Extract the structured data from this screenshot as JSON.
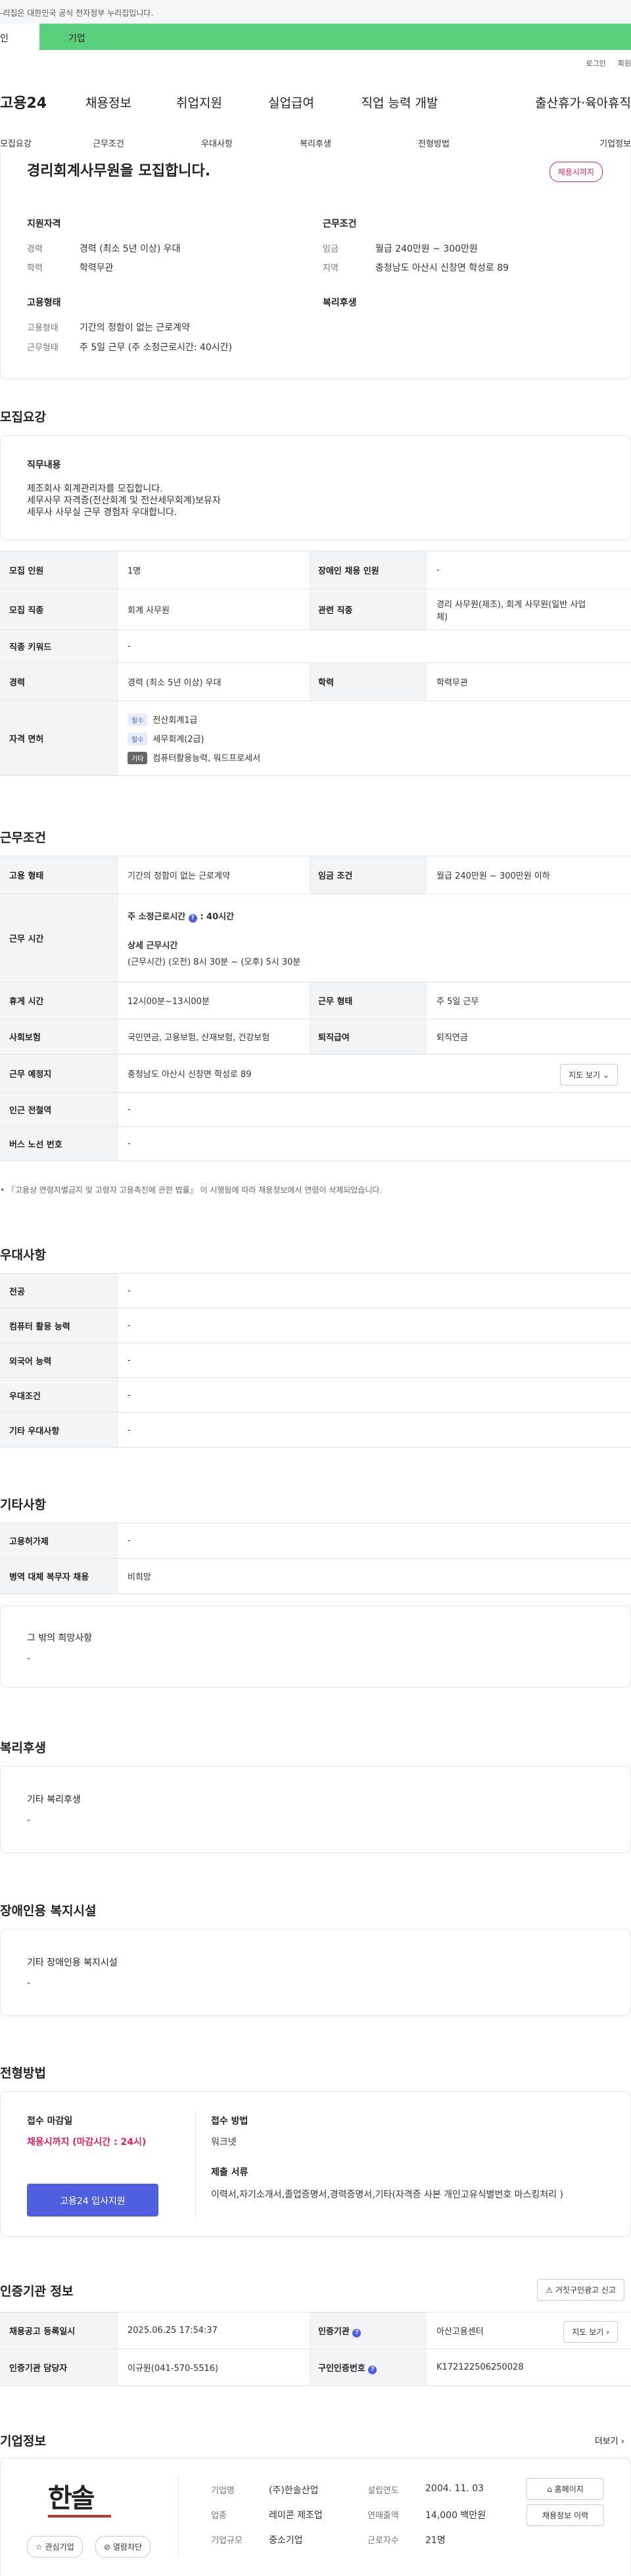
{
  "topbar": {
    "notice": "-리집은 대한민국 공식 전자정부 누리집입니다."
  },
  "tabs": {
    "personal": "인",
    "company": "기업"
  },
  "utility": {
    "login": "로그인",
    "join": "회원"
  },
  "gnb": {
    "logo": "고용24",
    "menu": [
      "채용정보",
      "취업지원",
      "실업급여",
      "직업 능력 개발",
      "출산휴가·육아휴직"
    ]
  },
  "lnb": [
    "모집요강",
    "근무조건",
    "우대사항",
    "복리후생",
    "전형방법",
    "기업정보"
  ],
  "summary": {
    "title": "경리회계사무원을 모집합니다.",
    "deadline_badge": "채용시까지",
    "qual_title": "지원자격",
    "qual": [
      {
        "label": "경력",
        "value": "경력 (최소 5년 이상) 우대"
      },
      {
        "label": "학력",
        "value": "학력무관"
      }
    ],
    "cond_title": "근무조건",
    "cond": [
      {
        "label": "임금",
        "value": "월급 240만원 ~ 300만원"
      },
      {
        "label": "지역",
        "value": "충청남도 아산시 신창면 학성로 89"
      }
    ],
    "emp_title": "고용형태",
    "emp": [
      {
        "label": "고용형태",
        "value": "기간의 정함이 없는 근로계약"
      },
      {
        "label": "근무형태",
        "value": "주 5일 근무 (주 소정근로시간: 40시간)"
      }
    ],
    "welfare_title": "복리후생"
  },
  "recruit": {
    "section_title": "모집요강",
    "job_box_title": "직무내용",
    "job_lines": [
      "제조회사 회계관리자를 모집합니다.",
      "세무사무 자격증(전산회계 및 전산세무회계)보유자",
      "세무사 사무실 근무 경험자 우대합니다."
    ],
    "rows": {
      "r1": {
        "l1": "모집 인원",
        "v1": "1명",
        "l2": "장애인 채용 인원",
        "v2": "-"
      },
      "r2": {
        "l1": "모집 직종",
        "v1": "회계 사무원",
        "l2": "관련 직종",
        "v2a": "경리 사무원(제조), 회계 사무원(일반 사업",
        "v2b": "체)"
      },
      "r3": {
        "l1": "직종 키워드",
        "v1": "-"
      },
      "r4": {
        "l1": "경력",
        "v1": "경력 (최소 5년 이상) 우대",
        "l2": "학력",
        "v2": "학력무관"
      },
      "r5": {
        "l1": "자격 면허",
        "items": [
          {
            "tag": "필수",
            "name": "전산회계1급"
          },
          {
            "tag": "필수",
            "name": "세무회계(2급)"
          },
          {
            "tag": "기타",
            "name": "컴퓨터활용능력, 워드프로세서"
          }
        ]
      }
    }
  },
  "work": {
    "section_title": "근무조건",
    "rows": {
      "emp": {
        "l1": "고용 형태",
        "v1": "기간의 정함이 없는 근로계약",
        "l2": "임금 조건",
        "v2": "월급 240만원 ~ 300만원 이하"
      },
      "time": {
        "l1": "근무 시간",
        "a": "주 소정근로시간",
        "b": ": 40시간",
        "c": "상세 근무시간",
        "d": "(근무시간) (오전) 8시 30분 ~ (오후) 5시 30분"
      },
      "rest": {
        "l1": "휴게 시간",
        "v1": "12시00분~13시00분",
        "l2": "근무 형태",
        "v2": "주 5일 근무"
      },
      "ins": {
        "l1": "사회보험",
        "v1": "국민연금, 고용보험, 산재보험, 건강보험",
        "l2": "퇴직급여",
        "v2": "퇴직연금"
      },
      "loc": {
        "l1": "근무 예정지",
        "v1": "충청남도 아산시 신창면 학성로 89",
        "btn": "지도 보기"
      },
      "subway": {
        "l1": "인근 전철역",
        "v1": "-"
      },
      "bus": {
        "l1": "버스 노선 번호",
        "v1": "-"
      }
    },
    "note": "• 『고용상 연령차별금지 및 고령자 고용촉진에 관한 법률』 이 시행됨에 따라 채용정보에서 연령이 삭제되었습니다."
  },
  "pref": {
    "section_title": "우대사항",
    "rows": [
      {
        "l": "전공",
        "v": "-"
      },
      {
        "l": "컴퓨터 활용 능력",
        "v": "-"
      },
      {
        "l": "외국어 능력",
        "v": "-"
      },
      {
        "l": "우대조건",
        "v": "-"
      },
      {
        "l": "기타 우대사항",
        "v": "-"
      }
    ]
  },
  "etc": {
    "section_title": "기타사항",
    "rows": [
      {
        "l": "고용허가제",
        "v": "-"
      },
      {
        "l": "병역 대체 복무자 채용",
        "v": "비희망"
      }
    ],
    "box_title": "그 밖의 희망사항",
    "box_value": "-"
  },
  "welfare": {
    "section_title": "복리후생",
    "box_title": "기타 복리후생",
    "box_value": "-"
  },
  "disabled": {
    "section_title": "장애인용 복지시설",
    "box_title": "기타 장애인용 복지시설",
    "box_value": "-"
  },
  "process": {
    "section_title": "전형방법",
    "deadline_label": "접수 마감일",
    "deadline_value": "채용시까지 (마감시간 : 24시)",
    "apply_btn": "고용24 입사지원",
    "method_label": "접수 방법",
    "method_value": "워크넷",
    "docs_label": "제출 서류",
    "docs_value": "이력서,자기소개서,졸업증명서,경력증명서,기타(자격증 사본 개인고유식별번호 마스킹처리 )"
  },
  "cert": {
    "section_title": "인증기관 정보",
    "report_btn": "거짓구인광고 신고",
    "r1": {
      "l1": "채용공고 등록일시",
      "v1": "2025.06.25 17:54:37",
      "l2": "인증기관",
      "v2": "아산고용센터",
      "btn": "지도 보기"
    },
    "r2": {
      "l1": "인증기관 담당자",
      "v1": "이규원(041-570-5516)",
      "l2": "구인인증번호",
      "v2": "K172122506250028"
    }
  },
  "company": {
    "section_title": "기업정보",
    "more": "더보기",
    "logo_text": "한솔",
    "fav_btn": "관심기업",
    "block_btn": "열람차단",
    "info": [
      {
        "l": "기업명",
        "v": "(주)한솔산업",
        "l2": "설립연도",
        "v2": "2004. 11. 03"
      },
      {
        "l": "업종",
        "v": "레미콘 제조업",
        "l2": "연매출액",
        "v2": "14,000 백만원"
      },
      {
        "l": "기업규모",
        "v": "중소기업",
        "l2": "근로자수",
        "v2": "21명"
      }
    ],
    "home_btn": "홈페이지",
    "history_btn": "채용정보 이력"
  }
}
